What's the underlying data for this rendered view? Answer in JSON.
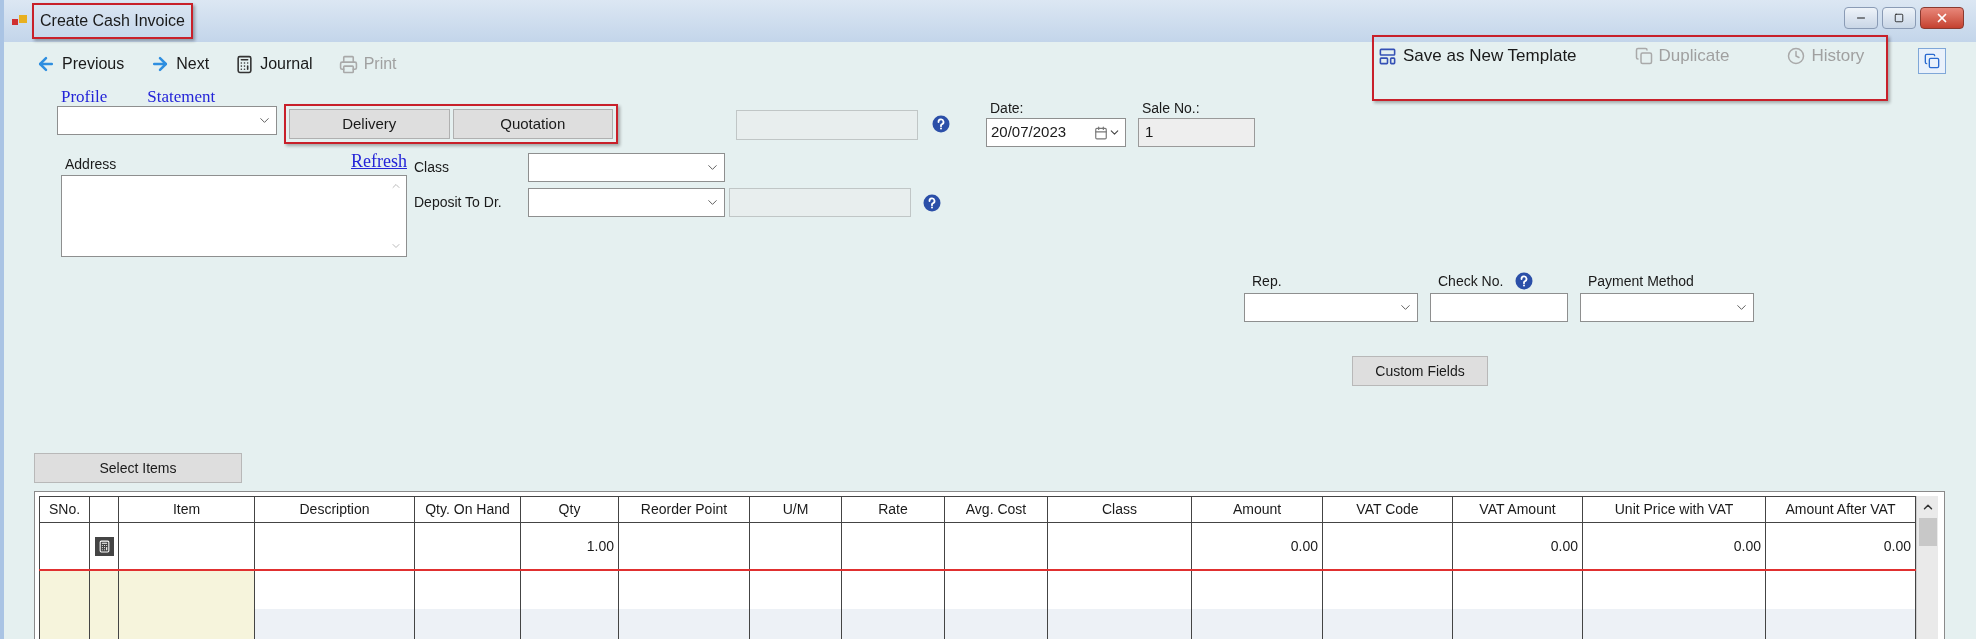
{
  "window": {
    "title": "Create Cash Invoice",
    "highlighted": true
  },
  "toolbar": [
    {
      "kind": "back",
      "label": "Previous",
      "disabled": false
    },
    {
      "kind": "forward",
      "label": "Next",
      "disabled": false
    },
    {
      "kind": "journal",
      "label": "Journal",
      "disabled": false
    },
    {
      "kind": "print",
      "label": "Print",
      "disabled": true
    }
  ],
  "right_toolbar": {
    "highlighted": true,
    "items": [
      {
        "kind": "template",
        "label": "Save as New Template",
        "disabled": false
      },
      {
        "kind": "duplicate",
        "label": "Duplicate",
        "disabled": true
      },
      {
        "kind": "history",
        "label": "History",
        "disabled": true
      }
    ]
  },
  "links": [
    "Profile",
    "Statement"
  ],
  "button_group": {
    "highlighted": true,
    "buttons": [
      "Delivery",
      "Quotation"
    ]
  },
  "date": {
    "label": "Date:",
    "value": "20/07/2023"
  },
  "sale_no": {
    "label": "Sale No.:",
    "value": "1"
  },
  "address": {
    "label": "Address",
    "link": "Refresh"
  },
  "class_label": "Class",
  "deposit_label": "Deposit To Dr.",
  "payment": [
    {
      "kind": "select",
      "label": "Rep.",
      "help": false
    },
    {
      "kind": "text",
      "label": "Check No.",
      "help": true
    },
    {
      "kind": "select",
      "label": "Payment Method",
      "help": false
    }
  ],
  "custom_fields_button": "Custom Fields",
  "select_items_button": "Select Items",
  "table": {
    "columns": [
      {
        "kind": "text",
        "label": "SNo."
      },
      {
        "kind": "icon"
      },
      {
        "kind": "text",
        "label": "Item"
      },
      {
        "kind": "text",
        "label": "Description"
      },
      {
        "kind": "number",
        "label": "Qty. On Hand"
      },
      {
        "kind": "number",
        "label": "Qty",
        "cells": [
          "1.00"
        ]
      },
      {
        "kind": "number",
        "label": "Reorder Point"
      },
      {
        "kind": "text",
        "label": "U/M"
      },
      {
        "kind": "number",
        "label": "Rate"
      },
      {
        "kind": "number",
        "label": "Avg. Cost"
      },
      {
        "kind": "text",
        "label": "Class"
      },
      {
        "kind": "number",
        "label": "Amount",
        "cells": [
          "0.00"
        ]
      },
      {
        "kind": "text",
        "label": "VAT Code"
      },
      {
        "kind": "number",
        "label": "VAT Amount",
        "cells": [
          "0.00"
        ]
      },
      {
        "kind": "number",
        "label": "Unit Price with VAT",
        "cells": [
          "0.00"
        ]
      },
      {
        "kind": "number",
        "label": "Amount After VAT",
        "cells": [
          "0.00"
        ]
      }
    ]
  }
}
